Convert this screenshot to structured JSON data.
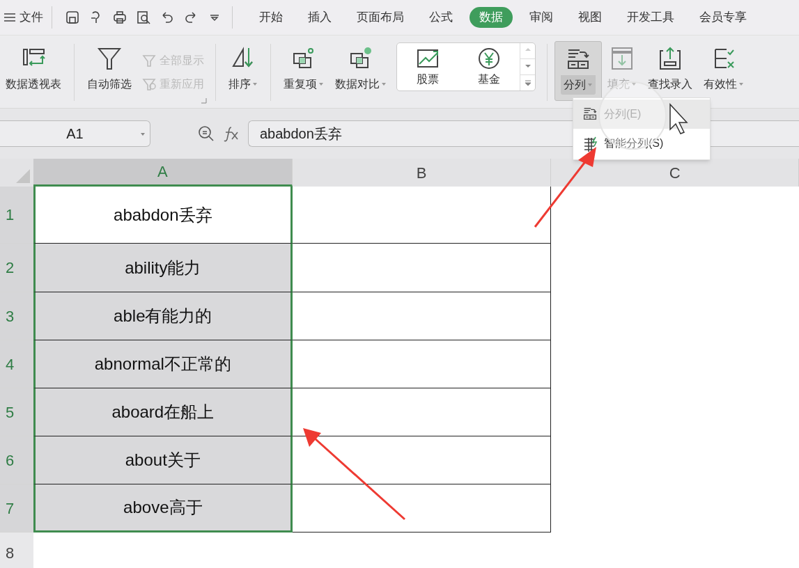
{
  "menu": {
    "file_label": "文件",
    "tabs": [
      {
        "label": "开始",
        "selected": false
      },
      {
        "label": "插入",
        "selected": false
      },
      {
        "label": "页面布局",
        "selected": false
      },
      {
        "label": "公式",
        "selected": false
      },
      {
        "label": "数据",
        "selected": true
      },
      {
        "label": "审阅",
        "selected": false
      },
      {
        "label": "视图",
        "selected": false
      },
      {
        "label": "开发工具",
        "selected": false
      },
      {
        "label": "会员专享",
        "selected": false
      }
    ]
  },
  "ribbon": [
    {
      "kind": "large",
      "label": "数据透视表",
      "caret": false,
      "disabled": false,
      "pressed": false
    },
    {
      "kind": "separator"
    },
    {
      "kind": "large",
      "label": "自动筛选",
      "caret": false,
      "disabled": false,
      "pressed": false
    },
    {
      "kind": "stack",
      "items": [
        {
          "label": "全部显示",
          "disabled": true
        },
        {
          "label": "重新应用",
          "disabled": true
        }
      ]
    },
    {
      "kind": "separator"
    },
    {
      "kind": "large",
      "label": "排序",
      "caret": true,
      "disabled": false,
      "pressed": false
    },
    {
      "kind": "separator"
    },
    {
      "kind": "large",
      "label": "重复项",
      "caret": true,
      "disabled": false,
      "pressed": false
    },
    {
      "kind": "large",
      "label": "数据对比",
      "caret": true,
      "disabled": false,
      "pressed": false
    },
    {
      "kind": "gallery",
      "items": [
        {
          "label": "股票"
        },
        {
          "label": "基金"
        }
      ]
    },
    {
      "kind": "separator"
    },
    {
      "kind": "large",
      "label": "分列",
      "caret": true,
      "disabled": false,
      "pressed": true
    },
    {
      "kind": "large",
      "label": "填充",
      "caret": true,
      "disabled": true,
      "pressed": false
    },
    {
      "kind": "large",
      "label": "查找录入",
      "caret": false,
      "disabled": false,
      "pressed": false
    },
    {
      "kind": "large",
      "label": "有效性",
      "caret": true,
      "disabled": false,
      "pressed": false
    }
  ],
  "dropdown": [
    {
      "label": "分列(E)",
      "highlighted": true
    },
    {
      "label": "智能分列(S)",
      "highlighted": false
    }
  ],
  "name_box": "A1",
  "formula": "ababdon丢弃",
  "columns": [
    {
      "label": "A",
      "selected": true
    },
    {
      "label": "B",
      "selected": false
    },
    {
      "label": "C",
      "selected": false
    }
  ],
  "rows": [
    {
      "number": "1",
      "selected": true,
      "cells": [
        {
          "text": "ababdon丢弃",
          "active": true
        }
      ]
    },
    {
      "number": "2",
      "selected": true,
      "cells": [
        {
          "text": "ability能力",
          "active": false
        }
      ]
    },
    {
      "number": "3",
      "selected": true,
      "cells": [
        {
          "text": "able有能力的",
          "active": false
        }
      ]
    },
    {
      "number": "4",
      "selected": true,
      "cells": [
        {
          "text": "abnormal不正常的",
          "active": false
        }
      ]
    },
    {
      "number": "5",
      "selected": true,
      "cells": [
        {
          "text": "aboard在船上",
          "active": false
        }
      ]
    },
    {
      "number": "6",
      "selected": true,
      "cells": [
        {
          "text": "about关于",
          "active": false
        }
      ]
    },
    {
      "number": "7",
      "selected": true,
      "cells": [
        {
          "text": "above高于",
          "active": false
        }
      ]
    },
    {
      "number": "8",
      "selected": false,
      "cells": []
    }
  ]
}
